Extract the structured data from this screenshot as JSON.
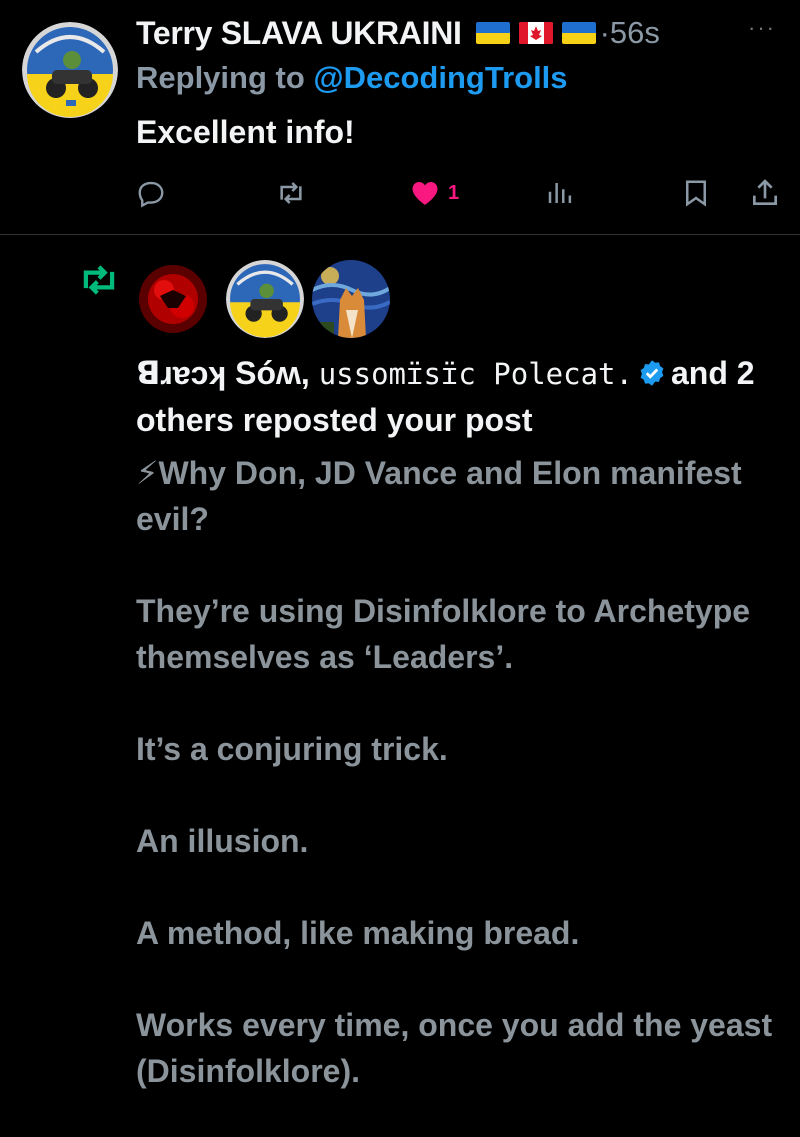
{
  "reply": {
    "author": "Terry SLAVA UKRAINI",
    "flags": [
      "ukraine-flag",
      "canada-flag",
      "ukraine-flag"
    ],
    "time": "·56s",
    "more": "···",
    "replying_prefix": "Replying to ",
    "replying_handle": "@DecodingTrolls",
    "text": "Excellent info!",
    "actions": {
      "reply_icon": "comment-icon",
      "repost_icon": "repost-icon",
      "like_icon": "heart-icon",
      "like_count": "1",
      "views_icon": "bar-chart-icon",
      "bookmark_icon": "bookmark-icon",
      "share_icon": "share-icon"
    },
    "colors": {
      "like": "#f91880",
      "link": "#1d9bf0",
      "repost": "#00ba7c"
    }
  },
  "repost_notification": {
    "icon": "repost-icon",
    "avatars": [
      "avatar-red-abstract",
      "avatar-slava-ukraini-badge",
      "avatar-starry-night-dog"
    ],
    "names": "ꓭɹɐɔʞ Sóʍ,",
    "names_mono": "ussomɪ̈sɪ̈c Polecat.",
    "suffix": "and 2 others reposted your post"
  },
  "post": {
    "lines": [
      "⚡Why Don, JD Vance and Elon manifest evil?",
      "",
      "They’re using Disinfolklore to Archetype themselves as ‘Leaders’.",
      "",
      "It’s a conjuring trick.",
      "",
      "An illusion.",
      "",
      "A method, like making bread.",
      "",
      "Works every time, once you add the yeast (Disinfolklore)."
    ]
  }
}
